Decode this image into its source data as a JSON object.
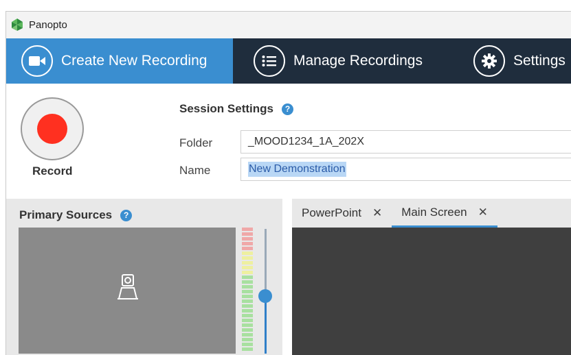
{
  "app": {
    "title": "Panopto"
  },
  "nav": {
    "tabs": [
      {
        "label": "Create New Recording",
        "icon": "video-camera-icon",
        "active": true
      },
      {
        "label": "Manage Recordings",
        "icon": "list-icon"
      },
      {
        "label": "Settings",
        "icon": "gear-icon"
      }
    ]
  },
  "record": {
    "label": "Record"
  },
  "session": {
    "title": "Session Settings",
    "help": "?",
    "folder_label": "Folder",
    "folder_value": "_MOOD1234_1A_202X",
    "name_label": "Name",
    "name_value": "New Demonstration"
  },
  "primary_sources": {
    "title": "Primary Sources",
    "help": "?"
  },
  "secondary_tabs": [
    {
      "label": "PowerPoint",
      "close": "✕"
    },
    {
      "label": "Main Screen",
      "close": "✕",
      "active": true
    }
  ],
  "colors": {
    "accent": "#3a8ed0",
    "nav_bg": "#1f2d3d",
    "record": "#ff3020",
    "meter_red": "#f0a8a8",
    "meter_yellow": "#eef0a0",
    "meter_green": "#a8e0a0"
  }
}
